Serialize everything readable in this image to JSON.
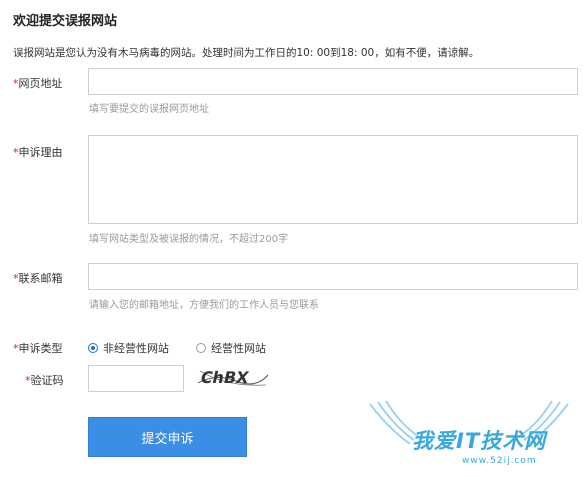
{
  "page": {
    "title": "欢迎提交误报网站",
    "intro": "误报网站是您认为没有木马病毒的网站。处理时间为工作日的10: 00到18: 00，如有不便，请谅解。"
  },
  "form": {
    "url": {
      "required_mark": "*",
      "label": "网页地址",
      "value": "",
      "hint": "填写要提交的误报网页地址"
    },
    "reason": {
      "required_mark": "*",
      "label": "申诉理由",
      "value": "",
      "hint": "填写网站类型及被误报的情况，不超过200字"
    },
    "email": {
      "required_mark": "*",
      "label": "联系邮箱",
      "value": "",
      "hint": "请输入您的邮箱地址，方便我们的工作人员与您联系"
    },
    "type": {
      "required_mark": "*",
      "label": "申诉类型",
      "options": [
        {
          "label": "非经营性网站",
          "checked": true
        },
        {
          "label": "经营性网站",
          "checked": false
        }
      ]
    },
    "captcha": {
      "required_mark": "*",
      "label": "验证码",
      "value": "",
      "image_text": "ChBX"
    },
    "submit_label": "提交申诉"
  },
  "watermark": {
    "text": "我爱IT技术网",
    "url": "www.52ij.com"
  },
  "colors": {
    "accent": "#3b8ee6",
    "required": "#e02020",
    "hint": "#9a9a9a",
    "border": "#cfcfcf",
    "watermark": "#3aa8e0"
  }
}
